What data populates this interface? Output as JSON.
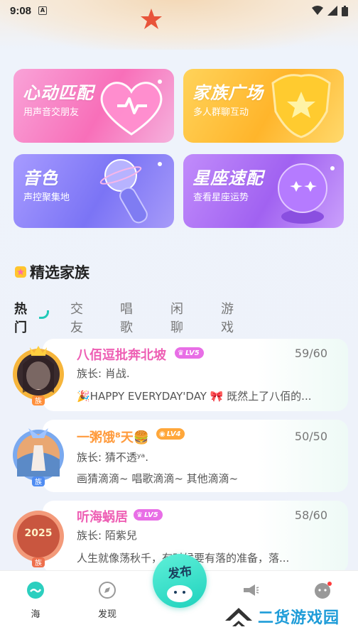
{
  "status": {
    "time": "9:08",
    "notif_letter": "A"
  },
  "features": [
    {
      "title": "心动匹配",
      "subtitle": "用声音交朋友",
      "icon": "heart-icon"
    },
    {
      "title": "家族广场",
      "subtitle": "多人群聊互动",
      "icon": "star-shield-icon"
    },
    {
      "title": "音色",
      "subtitle": "声控聚集地",
      "icon": "microphone-icon"
    },
    {
      "title": "星座速配",
      "subtitle": "查看星座运势",
      "icon": "crystal-ball-icon"
    }
  ],
  "section": {
    "title": "精选家族"
  },
  "tabs": [
    {
      "label": "热门",
      "active": true
    },
    {
      "label": "交友",
      "active": false
    },
    {
      "label": "唱歌",
      "active": false
    },
    {
      "label": "闲聊",
      "active": false
    },
    {
      "label": "游戏",
      "active": false
    }
  ],
  "families": [
    {
      "name": "八佰逗批奔北坡",
      "name_color": "#ee5fb4",
      "badge": "LV5",
      "badge_color": "#e86ee6",
      "count": "59/60",
      "owner": "族长: 肖战.",
      "desc": "🎉HAPPY EVERYDAY'DAY 🎀   既然上了八佰的...",
      "avatar_tag": "族"
    },
    {
      "name": "一粥饿⁸天🍔",
      "name_color": "#ff9b3d",
      "badge": "LV4",
      "badge_color": "#ffa73a",
      "count": "50/50",
      "owner": "族长: 猜不透ʸᵃ.",
      "desc": "画猜滴滴~ 唱歌滴滴~ 其他滴滴~",
      "avatar_tag": "族"
    },
    {
      "name": "听海蜗居",
      "name_color": "#ee5fb4",
      "badge": "LV5",
      "badge_color": "#e86ee6",
      "count": "58/60",
      "owner": "族长: 陌紫兒",
      "desc": "人生就像荡秋千，有时候要有落的准备，落...",
      "avatar_tag": "族",
      "avatar_text": "2025"
    }
  ],
  "nav": {
    "items": [
      {
        "label": "海",
        "icon": "sea-icon"
      },
      {
        "label": "发现",
        "icon": "discover-icon"
      },
      {
        "label": "",
        "icon": "megaphone-icon"
      },
      {
        "label": "",
        "icon": "chat-face-icon"
      }
    ],
    "publish": "发布"
  },
  "watermark": "二货游戏园"
}
